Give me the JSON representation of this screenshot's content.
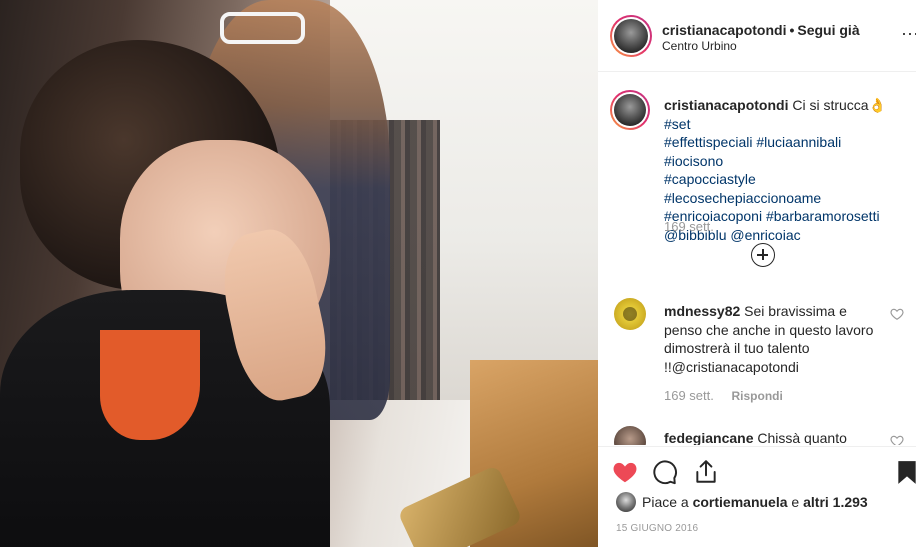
{
  "post": {
    "image_alt": "",
    "author": {
      "username": "cristianacapotondi",
      "separator": "•",
      "follow_label": "Segui già",
      "location": "Centro Urbino"
    },
    "caption": {
      "username": "cristianacapotondi",
      "text": "Ci si strucca",
      "emoji": "👌",
      "hashtags_line1": "#set",
      "hashtags": [
        "#effettispeciali #luciaannibali #iocisono",
        "#capocciastyle",
        "#lecosechepiaccionoame",
        "#enricoiacoponi #barbaramorosetti",
        "@bibbiblu @enricoiac"
      ],
      "time": "169 sett."
    },
    "comments": [
      {
        "username": "mdnessy82",
        "text": "Sei bravissima e penso che anche in questo lavoro dimostrerà il tuo talento !!@cristianacapotondi",
        "time": "169 sett.",
        "reply_label": "Rispondi"
      },
      {
        "username": "fedegiancane",
        "text": "Chissà quanto"
      }
    ],
    "likes": {
      "prefix": "Piace a",
      "user": "cortiemanuela",
      "middle": "e",
      "others": "altri 1.293"
    },
    "date": "15 giugno 2016"
  },
  "icons": {
    "like": "heart-filled-icon",
    "comment": "comment-bubble-icon",
    "share": "share-icon",
    "save": "bookmark-icon",
    "more": "more-options-icon",
    "load_more": "plus-circle-icon"
  },
  "colors": {
    "like_red": "#ed4956",
    "link_blue": "#003569",
    "meta_gray": "#999999",
    "text": "#262626"
  }
}
